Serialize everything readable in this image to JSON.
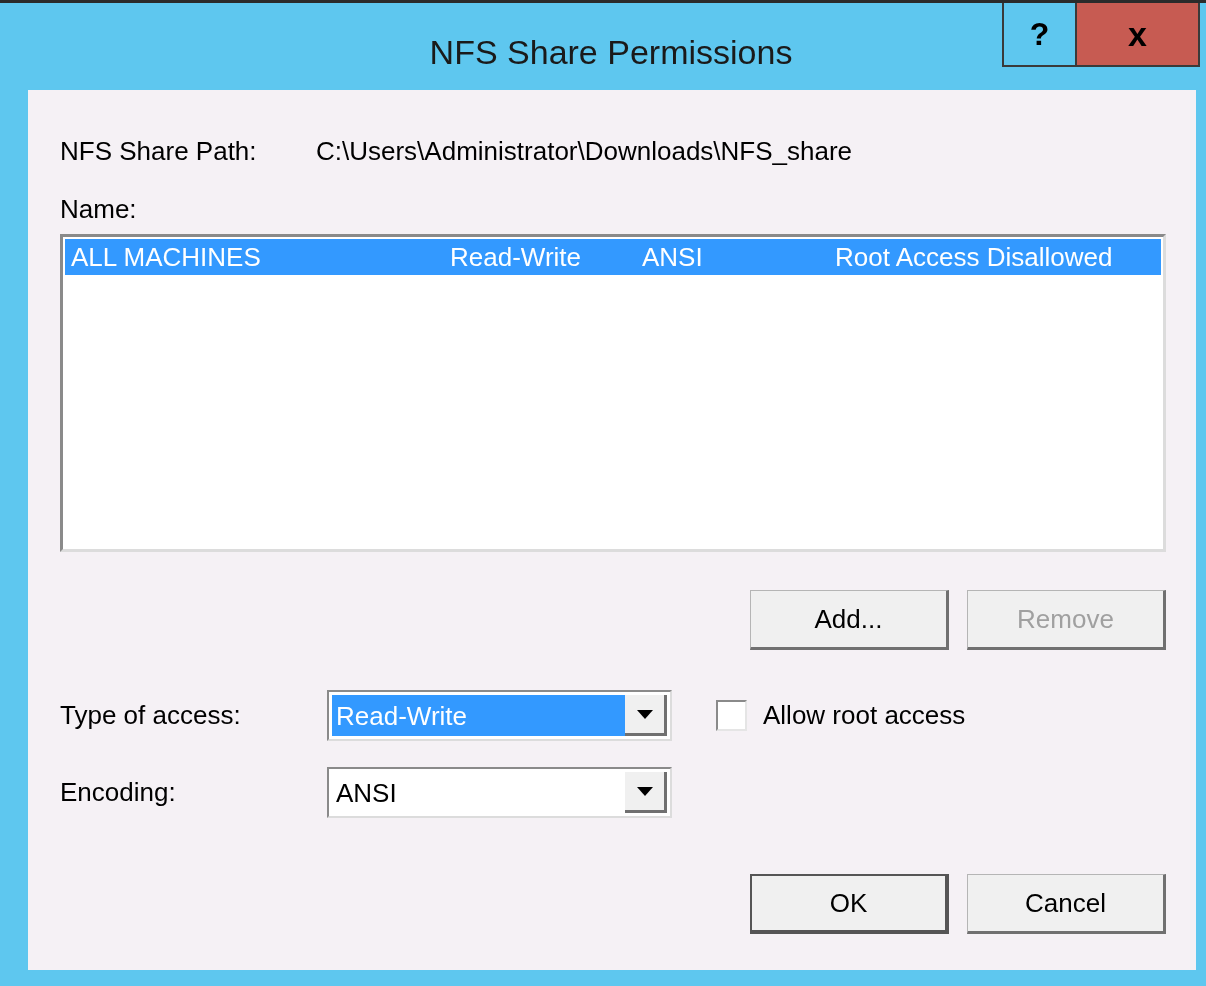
{
  "window": {
    "title": "NFS Share Permissions",
    "help_button": "?",
    "close_button": "x"
  },
  "share_path": {
    "label": "NFS Share Path:",
    "value": "C:\\Users\\Administrator\\Downloads\\NFS_share"
  },
  "name_label": "Name:",
  "list": {
    "rows": [
      {
        "cells": [
          "ALL MACHINES",
          "Read-Write",
          "ANSI",
          "Root Access Disallowed"
        ],
        "selected": true
      }
    ]
  },
  "list_buttons": [
    {
      "label": "Add...",
      "disabled": false
    },
    {
      "label": "Remove",
      "disabled": true
    }
  ],
  "type_of_access": {
    "label": "Type of access:",
    "value": "Read-Write",
    "text_selected": true
  },
  "allow_root": {
    "label": "Allow root access",
    "checked": false
  },
  "encoding": {
    "label": "Encoding:",
    "value": "ANSI",
    "text_selected": false
  },
  "footer_buttons": [
    {
      "label": "OK",
      "default": true,
      "disabled": false
    },
    {
      "label": "Cancel",
      "default": false,
      "disabled": false
    }
  ]
}
